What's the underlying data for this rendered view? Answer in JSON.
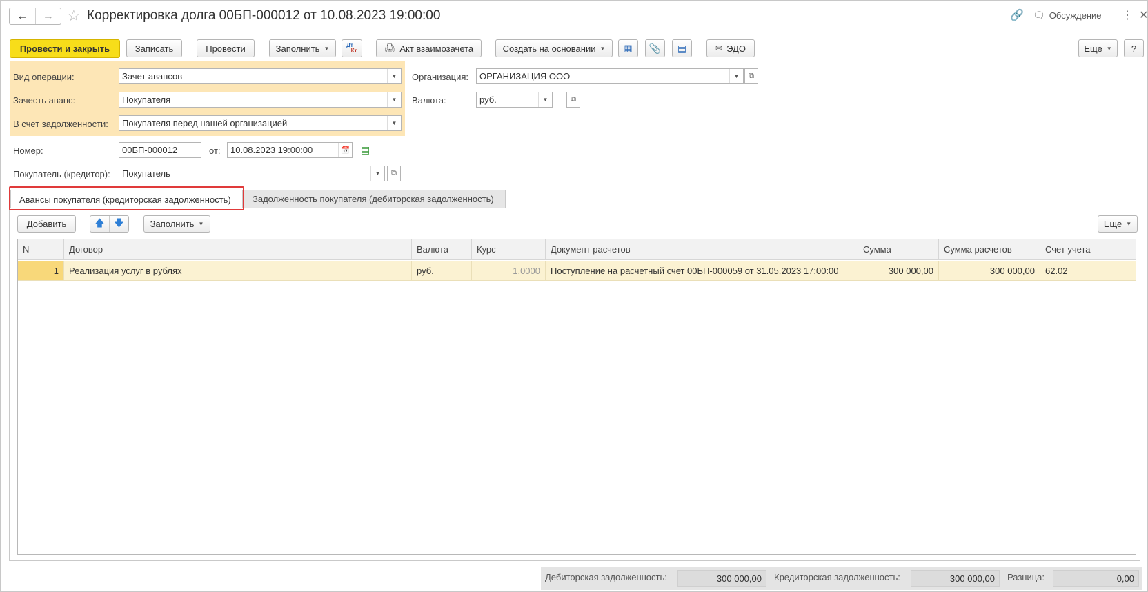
{
  "window": {
    "title": "Корректировка долга 00БП-000012 от 10.08.2023 19:00:00",
    "discussion": "Обсуждение",
    "menu_icon": "kebab-icon",
    "close_icon": "close-icon"
  },
  "toolbar": {
    "post_close": "Провести и закрыть",
    "save": "Записать",
    "post": "Провести",
    "fill": "Заполнить",
    "dtkt_top": "Дт",
    "dtkt_bottom": "Кт",
    "act": "Акт взаимозачета",
    "create_based": "Создать на основании",
    "edo": "ЭДО",
    "more": "Еще",
    "help": "?"
  },
  "form": {
    "operation_label": "Вид операции:",
    "operation_value": "Зачет авансов",
    "offset_label": "Зачесть аванс:",
    "offset_value": "Покупателя",
    "debt_label": "В счет задолженности:",
    "debt_value": "Покупателя перед нашей организацией",
    "org_label": "Организация:",
    "org_value": "ОРГАНИЗАЦИЯ ООО",
    "currency_label": "Валюта:",
    "currency_value": "руб.",
    "number_label": "Номер:",
    "number_value": "00БП-000012",
    "from_label": "от:",
    "date_value": "10.08.2023 19:00:00",
    "buyer_label": "Покупатель (кредитор):",
    "buyer_value": "Покупатель"
  },
  "tabs": [
    {
      "label": "Авансы покупателя (кредиторская задолженность)",
      "active": true
    },
    {
      "label": "Задолженность покупателя (дебиторская задолженность)",
      "active": false
    }
  ],
  "table_toolbar": {
    "add": "Добавить",
    "fill": "Заполнить",
    "more": "Еще"
  },
  "table": {
    "columns": [
      "N",
      "Договор",
      "Валюта",
      "Курс",
      "Документ расчетов",
      "Сумма",
      "Сумма расчетов",
      "Счет учета"
    ],
    "rows": [
      {
        "n": "1",
        "contract": "Реализация услуг в рублях",
        "currency": "руб.",
        "rate": "1,0000",
        "document": "Поступление на расчетный счет 00БП-000059 от 31.05.2023 17:00:00",
        "sum": "300 000,00",
        "settlement_sum": "300 000,00",
        "account": "62.02"
      }
    ]
  },
  "footer": {
    "debit_label": "Дебиторская задолженность:",
    "debit_value": "300 000,00",
    "credit_label": "Кредиторская задолженность:",
    "credit_value": "300 000,00",
    "diff_label": "Разница:",
    "diff_value": "0,00"
  },
  "colors": {
    "primary": "#f7dd1a",
    "highlight": "#fde6b6",
    "selected_row": "#fbf2d2",
    "tab_marker": "#e03a3a"
  }
}
